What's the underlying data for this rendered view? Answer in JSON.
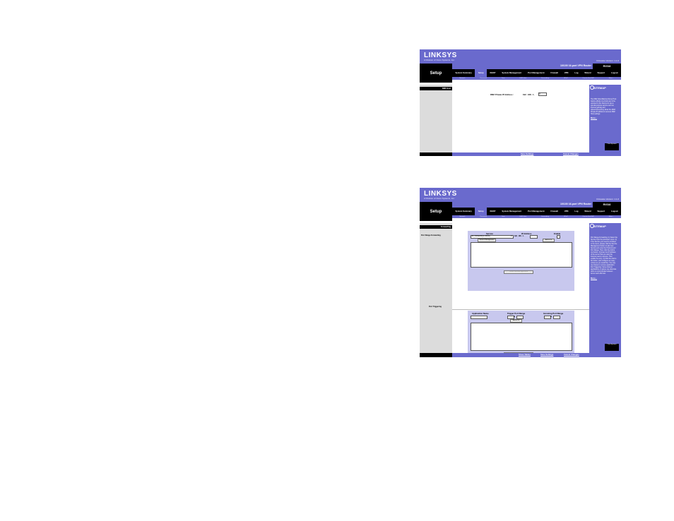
{
  "common": {
    "logo": "LINKSYS",
    "logo_sub": "A Division of Cisco Systems, Inc.",
    "firmware": "Firmware Version: 1.1.0",
    "section": "Setup",
    "product": "10/100 16-port VPN Router",
    "model": "RV016",
    "tabs": [
      "System Summary",
      "Setup",
      "DHCP",
      "System Management",
      "Port Management",
      "Firewall",
      "VPN",
      "Log",
      "Wizard",
      "Support",
      "Logout"
    ],
    "subtabs": [
      "Network",
      "Password",
      "Time",
      "DMZ Host",
      "Forwarding",
      "UPnP",
      "One-to-One NAT",
      "More..."
    ],
    "sitemap": "SITEMAP",
    "more": "More...",
    "cisco": "Cisco Systems"
  },
  "screen1": {
    "page_label": "DMZ Host",
    "field_label": "DMZ Private IP Address :",
    "ip_prefix": "192 . 168 . 1 .",
    "ip_last": "0",
    "help": "The DMZ (Demilitarized Zone) Host feature allows one local user to be exposed to the Internet to use a special-purpose service such as Internet gaming and videoconferencing. Enter the DMZ Private IP address to access DMZ Host settings.",
    "save": "Save Settings",
    "cancel": "Cancel Changes"
  },
  "screen2": {
    "page_label": "Forwarding",
    "port_range_label": "Port Range Forwarding",
    "service_header": "Service",
    "ip_header": "IP Address",
    "enable_header": "Enable",
    "service_value": "All (TCP&UDP)[1~65535]",
    "ip_prefix": "192 . 168 . 1 .",
    "service_mgmt_button": "Service Management",
    "add_list_button": "Add to list",
    "delete_button": "Delete selected application",
    "port_trigger_label": "Port Triggering",
    "app_name_header": "Application Name",
    "trigger_range_header": "Trigger Port Range",
    "incoming_range_header": "Incoming Port Range",
    "range_to": "to",
    "add_list_button2": "Add to list",
    "delete_button2": "Delete selected application",
    "help": "Port Range Forwarding: 1) Select the Service from the pull-down menu. 2) If the Service you need is not listed in the menu, please click the Service Management button to add new Service and enter the Protocol and Port Range. Then click the Add to List button. 3) Enter the IP Address of the server that you want the Internet users to access. Then enable the entry. 4) Click the Add to list button, and configure as many entries as you would like. You may use Delete to remove application. Port Triggering: Some Internet applications or games use alternate ports to communicate between server and LAN host.",
    "show_tables": "Show Tables",
    "save": "Save Settings",
    "cancel": "Cancel Changes"
  },
  "colors": {
    "brand": "#6a6acd",
    "black": "#000000",
    "panel": "#c8c8ee"
  }
}
